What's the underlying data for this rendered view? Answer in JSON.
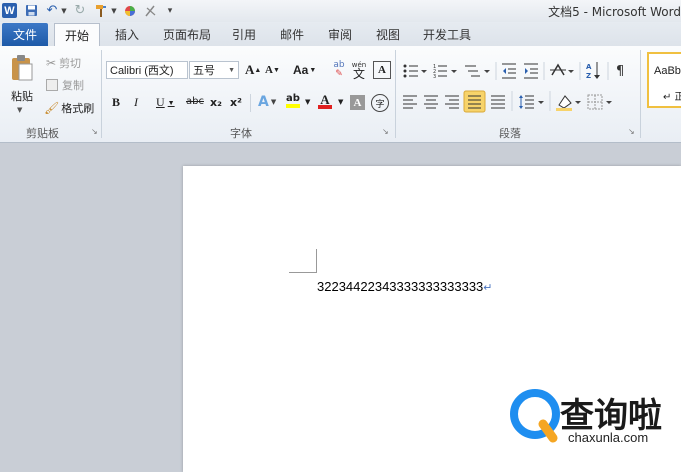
{
  "titlebar": {
    "title": "文档5 - Microsoft Word",
    "app_icon": "W",
    "qat_icons": [
      "save-icon",
      "undo-icon",
      "redo-icon",
      "format-painter-icon",
      "color-icon",
      "clear-icon",
      "customize-icon"
    ]
  },
  "tabs": {
    "file": "文件",
    "items": [
      "开始",
      "插入",
      "页面布局",
      "引用",
      "邮件",
      "审阅",
      "视图",
      "开发工具"
    ],
    "active": "开始"
  },
  "clipboard": {
    "paste": "粘贴",
    "cut": "剪切",
    "copy": "复制",
    "format_painter": "格式刷",
    "label": "剪贴板"
  },
  "font": {
    "font_name": "Calibri (西文)",
    "font_size": "五号",
    "aa": "Aa",
    "label": "字体",
    "bold": "B",
    "italic": "I",
    "underline": "U",
    "strike": "abc",
    "sub": "x₂",
    "sup": "x²",
    "text_effect": "A",
    "highlight": "ab",
    "font_color": "A",
    "char_shade": "A",
    "enclose": "字",
    "grow": "A",
    "shrink": "A",
    "phonetic": "wén",
    "border_char": "A"
  },
  "paragraph": {
    "label": "段落"
  },
  "styles": {
    "preview": "AaBb",
    "preview_sub": "↵ 正"
  },
  "document": {
    "text": "32234422343333333333333",
    "para_mark": "↵"
  },
  "watermark": {
    "text": "查询啦",
    "url": "chaxunla.com"
  },
  "colors": {
    "file_tab": "#2a66b8",
    "highlight_yellow": "#ffff00",
    "font_red": "#e02020",
    "justify_active": "#f7d36a"
  }
}
